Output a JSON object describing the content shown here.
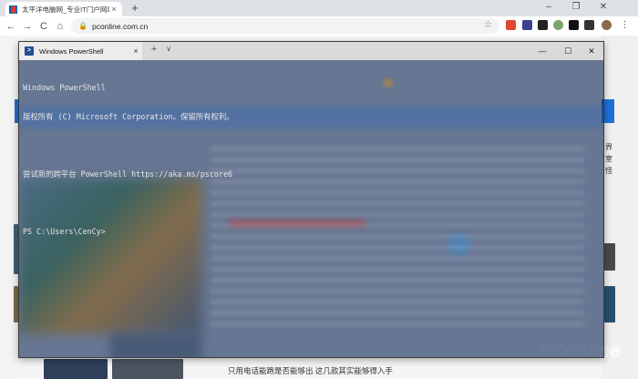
{
  "browser": {
    "tab_title": "太平洋电脑网_专业IT门户网站",
    "tab_close": "×",
    "new_tab": "+",
    "url": "pconline.com.cn",
    "window_controls": {
      "minimize": "–",
      "maximize": "❐",
      "close": "✕"
    },
    "nav": {
      "back": "←",
      "forward": "→",
      "reload": "C",
      "home": "⌂"
    },
    "lock": "🔒",
    "star": "☆"
  },
  "page": {
    "side_chars": [
      "界",
      "室",
      "怪"
    ],
    "bottom_text": "只用电话能跑是否能够出 这几款其实能够得入手",
    "watermark": "PConline"
  },
  "powershell": {
    "tab_title": "Windows PowerShell",
    "tab_close": "×",
    "new_tab": "+",
    "dropdown": "∨",
    "window_controls": {
      "minimize": "—",
      "maximize": "☐",
      "close": "✕"
    },
    "lines": [
      "Windows PowerShell",
      "版权所有 (C) Microsoft Corporation。保留所有权利。",
      "",
      "尝试新的跨平台 PowerShell https://aka.ms/pscore6",
      "",
      "PS C:\\Users\\CenCy>"
    ]
  },
  "colors": {
    "console_bg": "#102855",
    "console_text": "#e6e6e6",
    "accent_blue": "#1e6fd9"
  },
  "icons": {
    "ps_icon": "powershell-icon",
    "lock": "lock-icon",
    "star": "star-icon"
  }
}
